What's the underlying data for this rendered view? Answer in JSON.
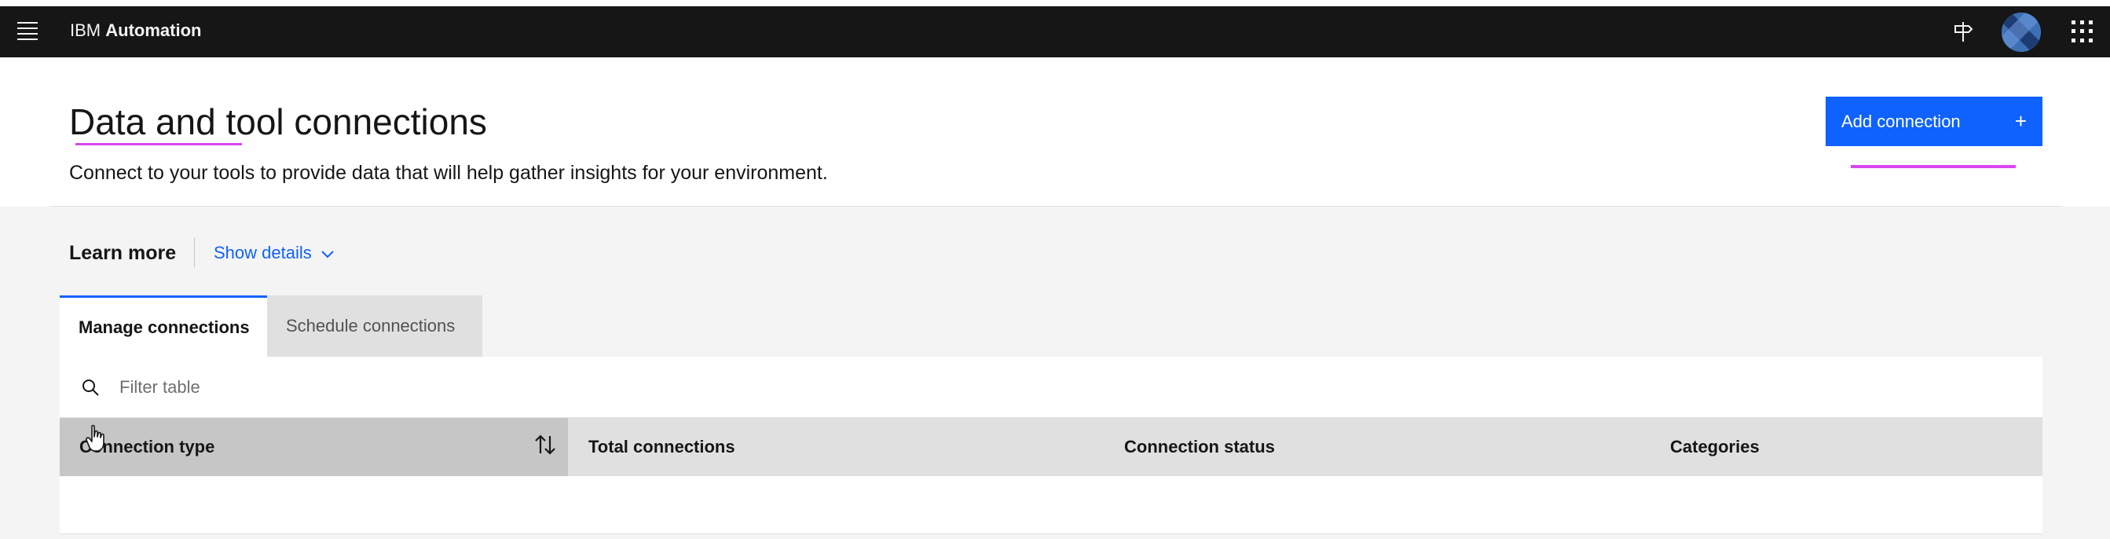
{
  "topbar": {
    "brand_prefix": "IBM",
    "brand_name": "Automation",
    "icons": [
      "menu-icon",
      "signpost-icon",
      "avatar",
      "app-switcher-icon"
    ]
  },
  "header": {
    "title": "Data and tool connections",
    "subtitle": "Connect to your tools to provide data that will help gather insights for your environment.",
    "add_button_label": "Add connection",
    "add_button_icon": "+"
  },
  "learn_more": {
    "label": "Learn more",
    "toggle_label": "Show details"
  },
  "tabs": [
    {
      "label": "Manage connections",
      "active": true
    },
    {
      "label": "Schedule connections",
      "active": false
    }
  ],
  "filter": {
    "placeholder": "Filter table",
    "value": ""
  },
  "table": {
    "columns": [
      {
        "label": "Connection type",
        "sortable": true
      },
      {
        "label": "Total connections"
      },
      {
        "label": "Connection status"
      },
      {
        "label": "Categories"
      }
    ],
    "rows": []
  },
  "colors": {
    "topbar": "#161616",
    "primary": "#0f62fe",
    "annotation": "#d946ef",
    "background": "#f4f4f4"
  }
}
